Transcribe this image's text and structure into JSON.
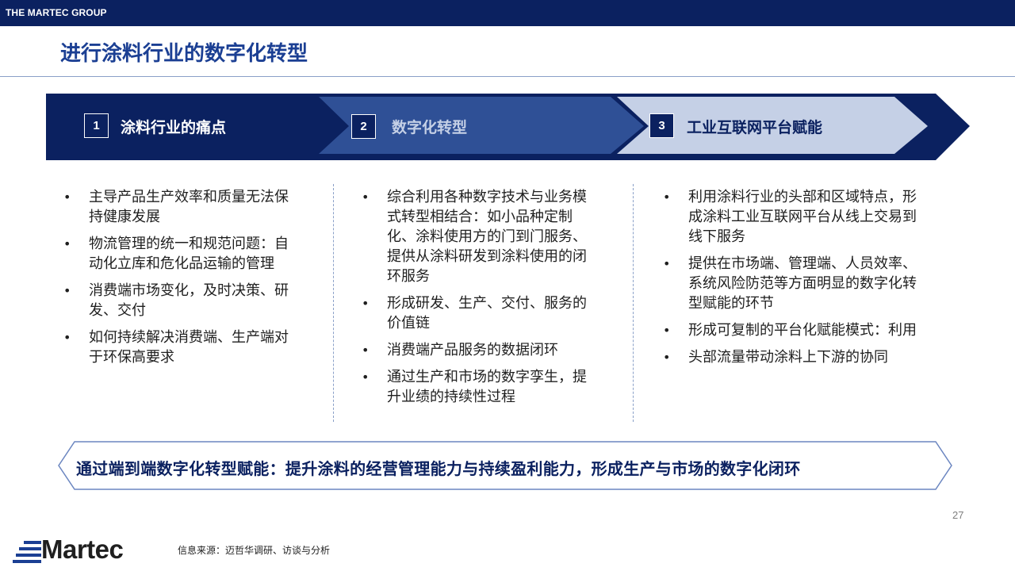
{
  "header": {
    "brand": "THE MARTEC GROUP",
    "title": "进行涂料行业的数字化转型"
  },
  "steps": [
    {
      "num": "1",
      "label": "涂料行业的痛点"
    },
    {
      "num": "2",
      "label": "数字化转型"
    },
    {
      "num": "3",
      "label": "工业互联网平台赋能"
    }
  ],
  "columns": [
    {
      "bullets": [
        "主导产品生产效率和质量无法保持健康发展",
        "物流管理的统一和规范问题：自动化立库和危化品运输的管理",
        "消费端市场变化，及时决策、研发、交付",
        "如何持续解决消费端、生产端对于环保高要求"
      ]
    },
    {
      "bullets": [
        "综合利用各种数字技术与业务模式转型相结合：如小品种定制化、涂料使用方的门到门服务、提供从涂料研发到涂料使用的闭环服务",
        "形成研发、生产、交付、服务的价值链",
        "消费端产品服务的数据闭环",
        "通过生产和市场的数字孪生，提升业绩的持续性过程"
      ]
    },
    {
      "bullets": [
        "利用涂料行业的头部和区域特点，形成涂料工业互联网平台从线上交易到线下服务",
        "提供在市场端、管理端、人员效率、系统风险防范等方面明显的数字化转型赋能的环节",
        "形成可复制的平台化赋能模式：利用",
        "头部流量带动涂料上下游的协同"
      ]
    }
  ],
  "banner": {
    "text": "通过端到端数字化转型赋能：提升涂料的经营管理能力与持续盈利能力，形成生产与市场的数字化闭环"
  },
  "footer": {
    "page_number": "27",
    "logo_text": "Martec",
    "source": "信息来源：迈哲华调研、访谈与分析"
  },
  "colors": {
    "navy": "#0b2160",
    "mid_blue": "#2f5096",
    "light_blue": "#c5d0e6",
    "title_blue": "#1b3f93"
  }
}
